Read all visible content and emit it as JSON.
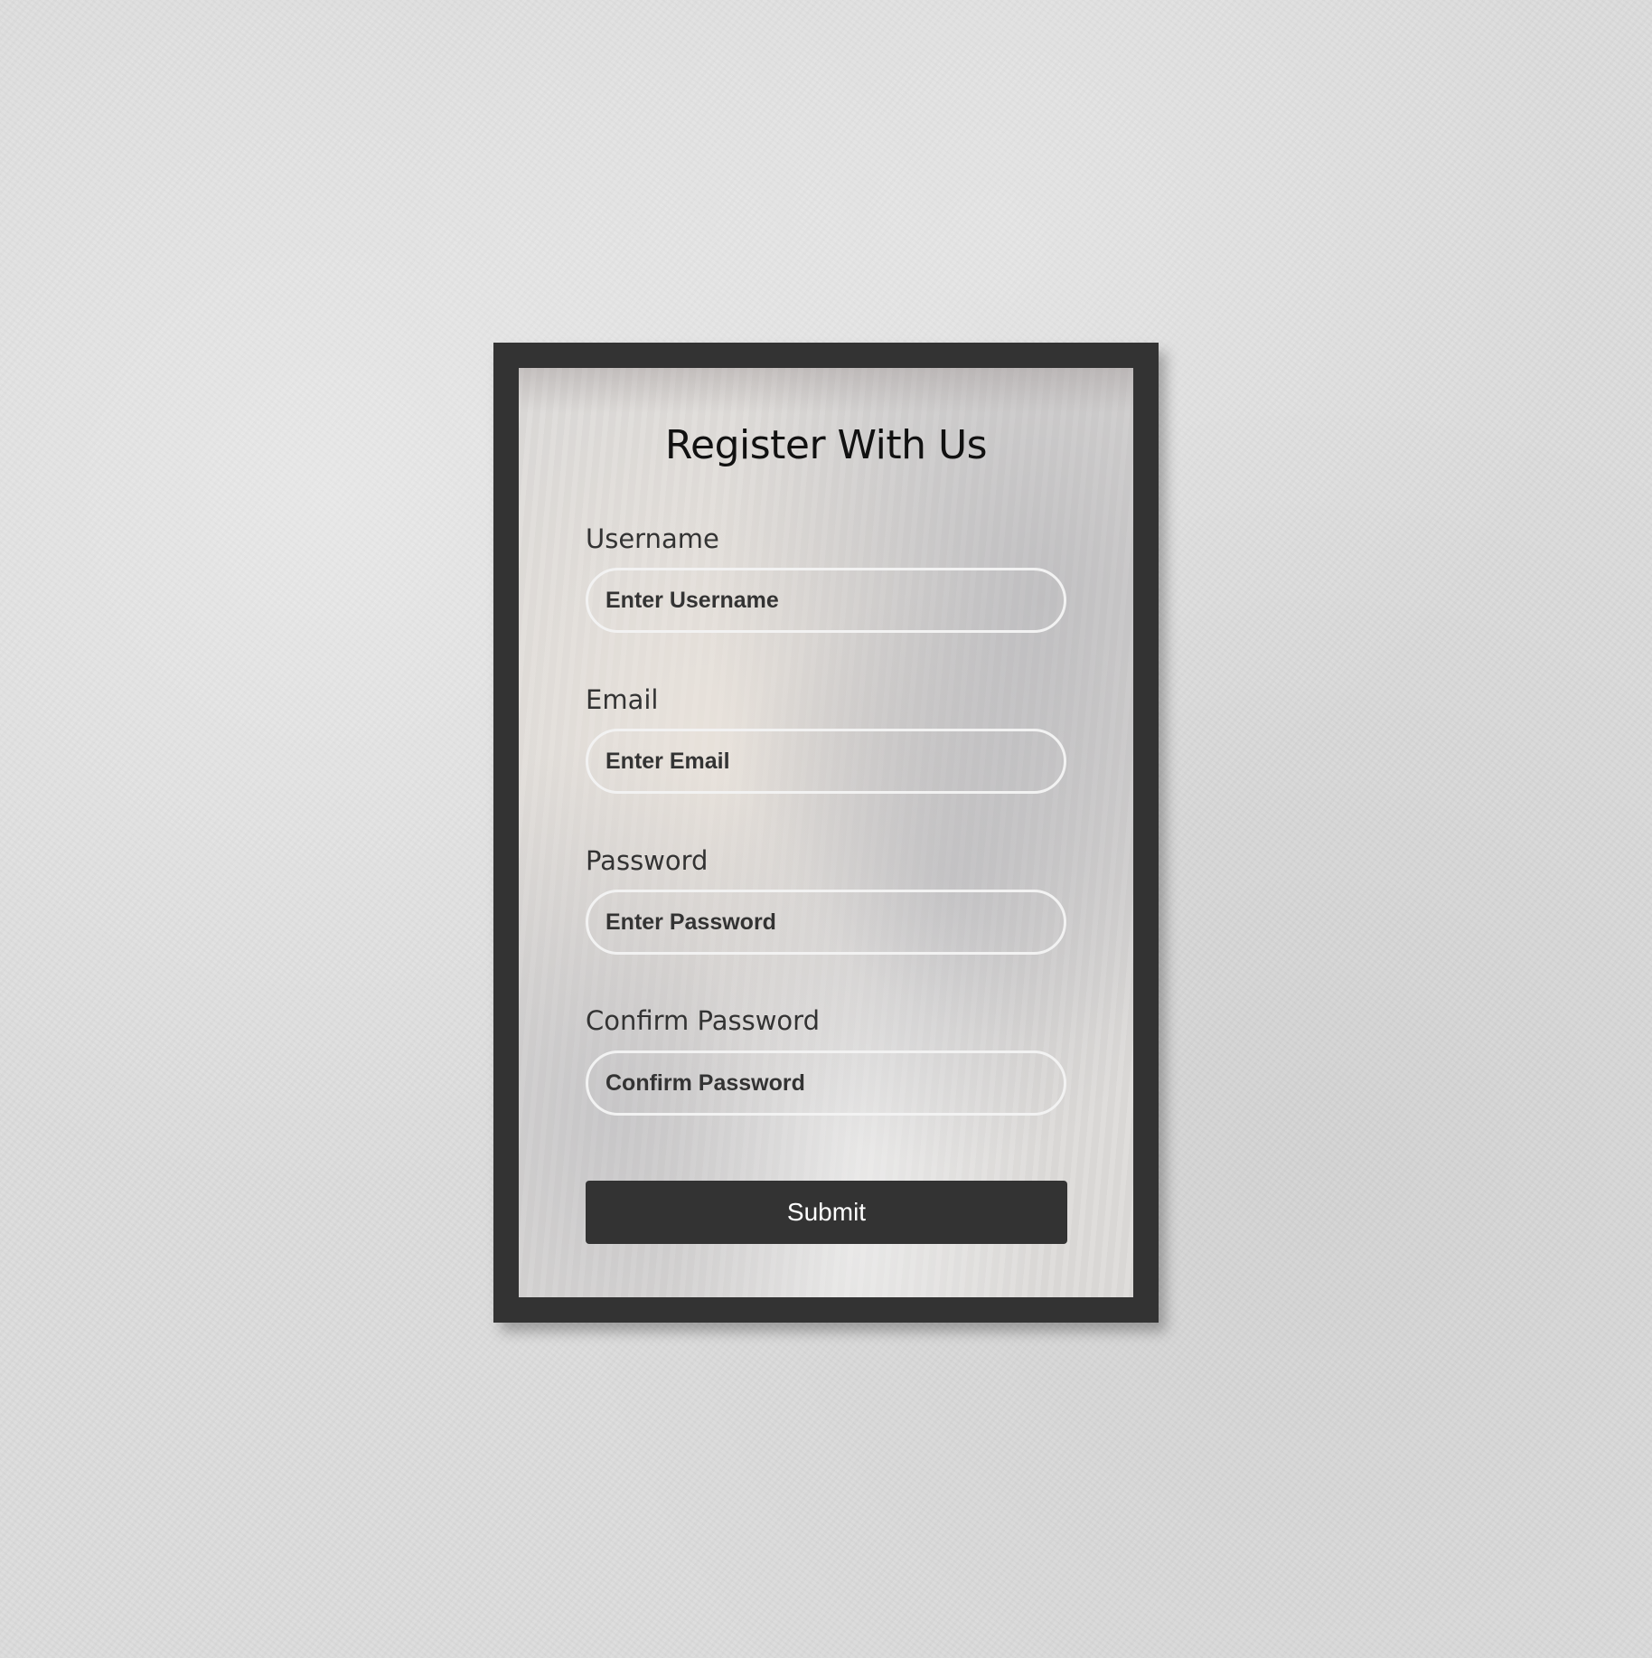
{
  "form": {
    "title": "Register With Us",
    "fields": [
      {
        "label": "Username",
        "placeholder": "Enter Username"
      },
      {
        "label": "Email",
        "placeholder": "Enter Email"
      },
      {
        "label": "Password",
        "placeholder": "Enter Password"
      },
      {
        "label": "Confirm Password",
        "placeholder": "Confirm Password"
      }
    ],
    "submit_label": "Submit"
  },
  "colors": {
    "frame": "#333333",
    "button": "#333333",
    "input_border": "#f2f2f2"
  }
}
